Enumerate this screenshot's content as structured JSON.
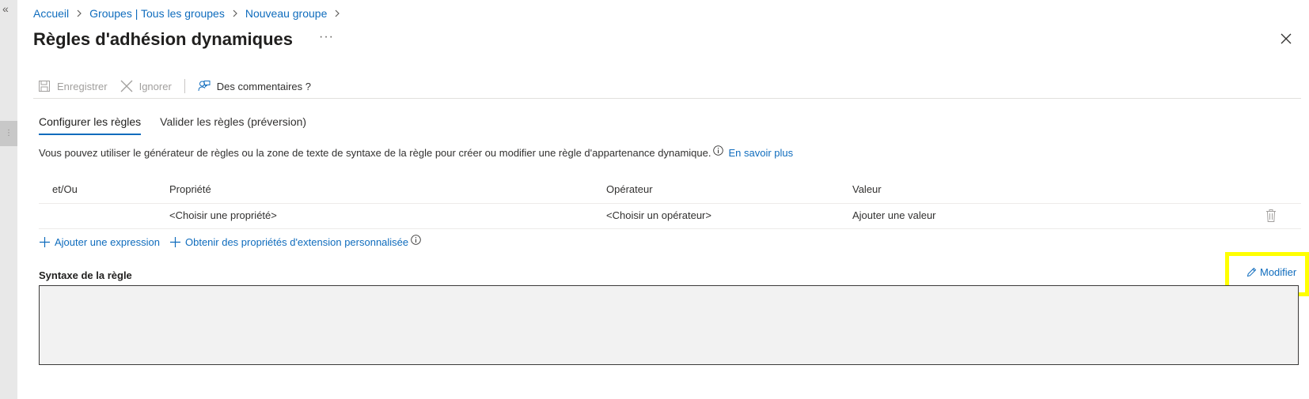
{
  "breadcrumb": {
    "items": [
      "Accueil",
      "Groupes | Tous les groupes",
      "Nouveau groupe"
    ]
  },
  "page": {
    "title": "Règles d'adhésion dynamiques",
    "more": "···"
  },
  "toolbar": {
    "save_label": "Enregistrer",
    "ignore_label": "Ignorer",
    "feedback_label": "Des commentaires ?"
  },
  "tabs": [
    {
      "label": "Configurer les règles",
      "active": true
    },
    {
      "label": "Valider les règles (préversion)",
      "active": false
    }
  ],
  "description": {
    "text": "Vous pouvez utiliser le générateur de règles ou la zone de texte de syntaxe de la règle pour créer ou modifier une règle d'appartenance dynamique.",
    "link": "En savoir plus"
  },
  "rule_grid": {
    "headers": [
      "et/Ou",
      "Propriété",
      "Opérateur",
      "Valeur"
    ],
    "row": {
      "andor": "",
      "property": "<Choisir une propriété>",
      "operator": "<Choisir un opérateur>",
      "value": "Ajouter une valeur"
    }
  },
  "actions": {
    "add_expression": "Ajouter une expression",
    "get_extension_props": "Obtenir des propriétés d'extension personnalisée"
  },
  "syntax": {
    "label": "Syntaxe de la règle",
    "edit_label": "Modifier",
    "value": ""
  },
  "colors": {
    "accent": "#0f6cbd",
    "highlight": "#ffff00",
    "syntax_bg": "#f2f2f2"
  },
  "icons": {
    "rail": "double-chevron-left-icon",
    "close": "close-icon",
    "save": "save-icon",
    "ignore": "close-icon",
    "feedback": "feedback-icon",
    "info": "info-icon",
    "add": "plus-icon",
    "delete": "trash-icon",
    "edit": "pencil-icon"
  }
}
